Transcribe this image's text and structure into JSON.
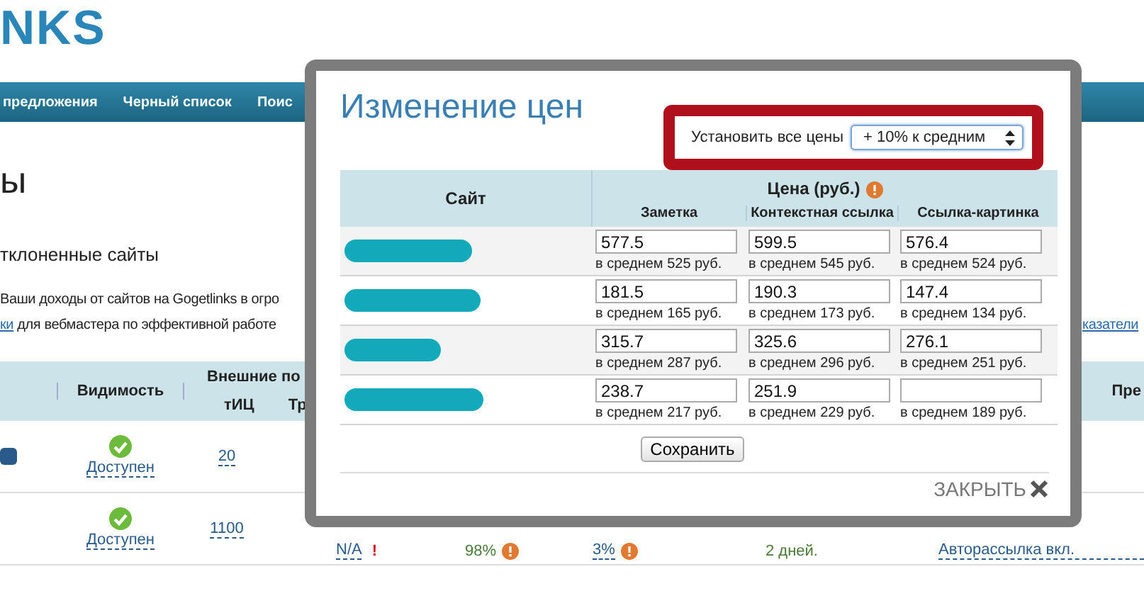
{
  "logo": "NKS",
  "nav": [
    {
      "label": "предложения"
    },
    {
      "label": "Черный список"
    },
    {
      "label": "Поис"
    }
  ],
  "page_heading": "ы",
  "filter_link": "тклоненные сайты",
  "intro": {
    "line_1": "Ваши доходы от сайтов на Gogetlinks в огро",
    "link": "ки",
    "line_2": "для вебмастера по эффективной работе",
    "right_link": "казатели"
  },
  "table": {
    "headers": {
      "visibility": "Видимость",
      "external": "Внешние по",
      "tic": "тИЦ",
      "traffic": "Тр",
      "right": "Пре"
    },
    "rows": [
      {
        "available": true,
        "visibility": "Доступен",
        "tic": "20"
      },
      {
        "available": true,
        "visibility": "Доступен",
        "tic": "1100",
        "na": "N/A",
        "na_mark": "!",
        "percent_1": "98%",
        "percent_2": "3%",
        "days": "2 дней.",
        "mailing": "Авторассылка вкл."
      }
    ]
  },
  "modal": {
    "title": "Изменение цен",
    "set_all_label": "Установить все цены",
    "set_all_value": "+ 10% к средним",
    "columns": {
      "site": "Сайт",
      "price": "Цена (руб.)",
      "sub": [
        "Заметка",
        "Контекстная ссылка",
        "Ссылка-картинка"
      ]
    },
    "rows": [
      {
        "prices": [
          {
            "value": "577.5",
            "avg": "в среднем 525 руб."
          },
          {
            "value": "599.5",
            "avg": "в среднем 545 руб."
          },
          {
            "value": "576.4",
            "avg": "в среднем 524 руб."
          }
        ]
      },
      {
        "prices": [
          {
            "value": "181.5",
            "avg": "в среднем 165 руб."
          },
          {
            "value": "190.3",
            "avg": "в среднем 173 руб."
          },
          {
            "value": "147.4",
            "avg": "в среднем 134 руб."
          }
        ]
      },
      {
        "prices": [
          {
            "value": "315.7",
            "avg": "в среднем 287 руб."
          },
          {
            "value": "325.6",
            "avg": "в среднем 296 руб."
          },
          {
            "value": "276.1",
            "avg": "в среднем 251 руб."
          }
        ]
      },
      {
        "prices": [
          {
            "value": "238.7",
            "avg": "в среднем 217 руб."
          },
          {
            "value": "251.9",
            "avg": "в среднем 229 руб."
          },
          {
            "avg": "в среднем 189 руб."
          }
        ]
      }
    ],
    "save": "Сохранить",
    "close": "ЗАКРЫТЬ"
  }
}
